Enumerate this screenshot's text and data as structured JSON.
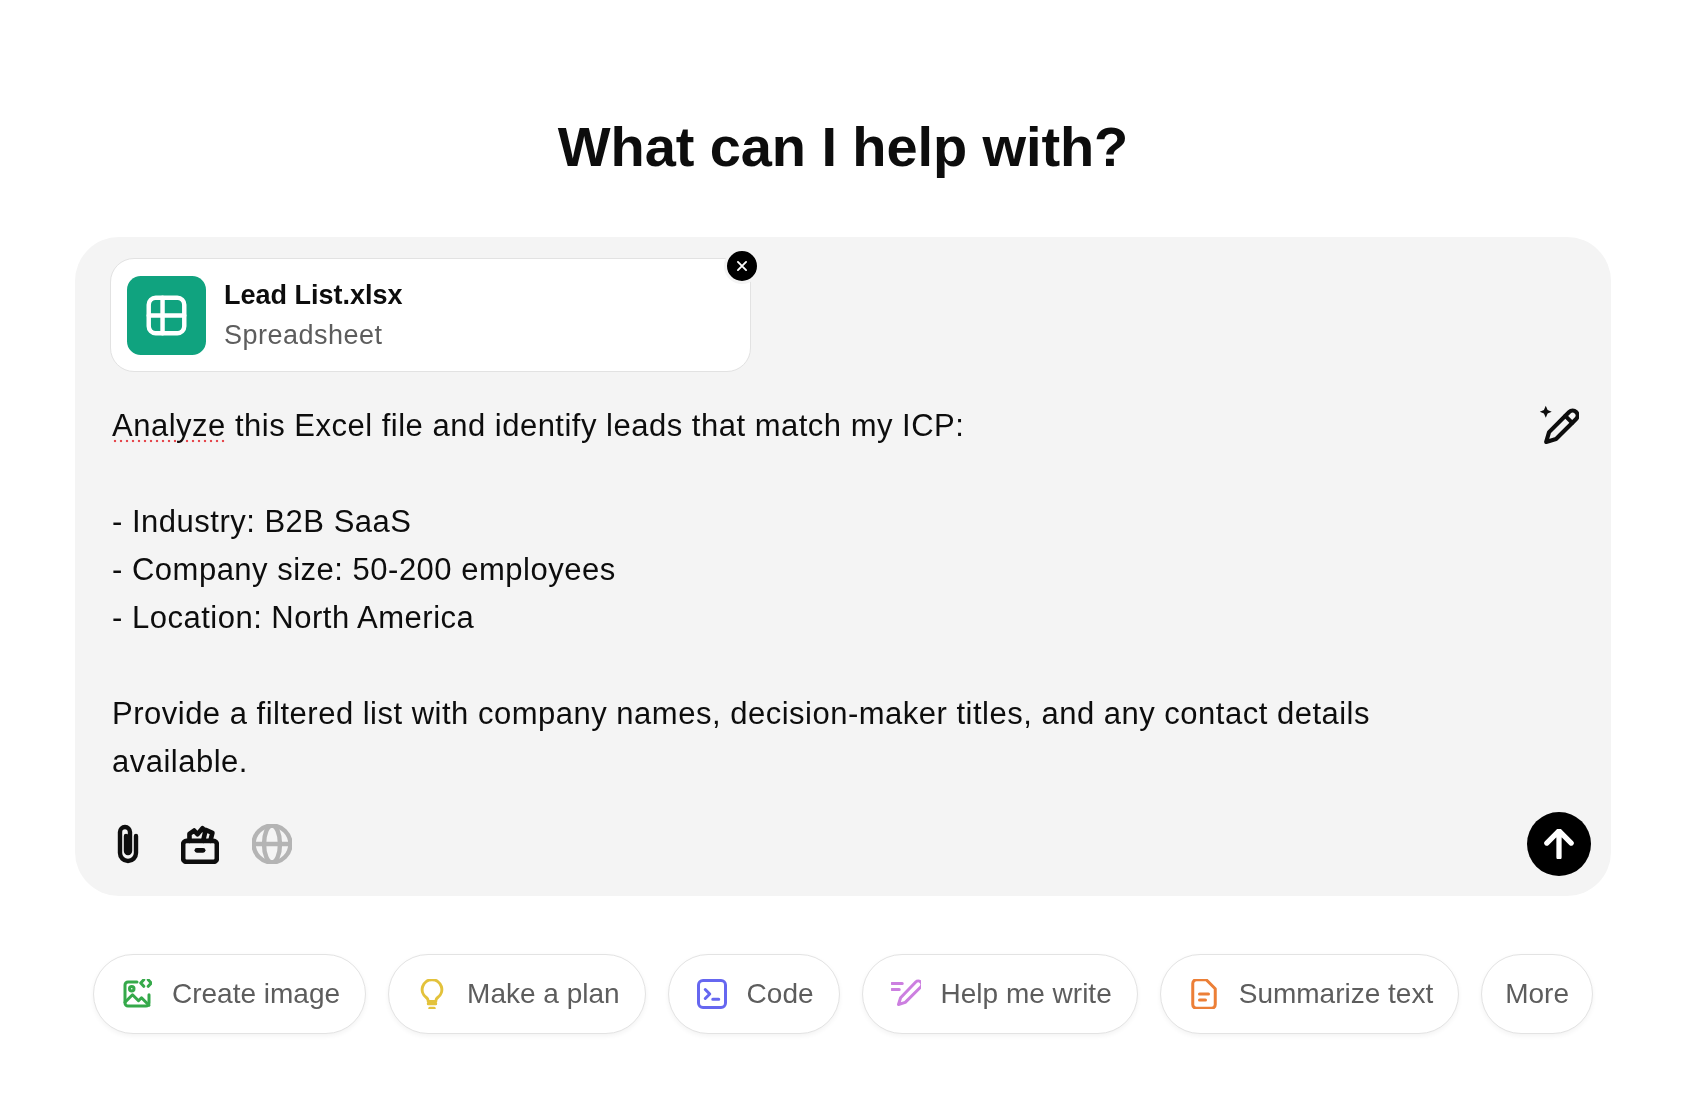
{
  "heading": "What can I help with?",
  "composer": {
    "attachment": {
      "name": "Lead List.xlsx",
      "type": "Spreadsheet"
    },
    "prompt": {
      "paragraphs": [
        [
          {
            "text": "Analyze",
            "misspelled": true
          },
          {
            "text": " this Excel file and identify leads that match my ICP:",
            "misspelled": false
          }
        ],
        [
          {
            "text": "- Industry: B2B SaaS\n- Company size: 50-200 employees\n- Location: North America",
            "misspelled": false
          }
        ],
        [
          {
            "text": "Provide a filtered list with company names, decision-maker titles, and any contact details available.",
            "misspelled": false
          }
        ]
      ]
    },
    "toolbar": [
      {
        "kind": "paperclip",
        "disabled": false
      },
      {
        "kind": "box",
        "disabled": false
      },
      {
        "kind": "globe",
        "disabled": true
      }
    ]
  },
  "suggestions": [
    {
      "label": "Create image",
      "kind": "image",
      "color": "#35a94a"
    },
    {
      "label": "Make a plan",
      "kind": "bulb",
      "color": "#e3c23b"
    },
    {
      "label": "Code",
      "kind": "terminal",
      "color": "#6667f0"
    },
    {
      "label": "Help me write",
      "kind": "pen",
      "color": "#cc7fe0"
    },
    {
      "label": "Summarize text",
      "kind": "document",
      "color": "#ec7f37"
    },
    {
      "label": "More",
      "kind": "more"
    }
  ]
}
